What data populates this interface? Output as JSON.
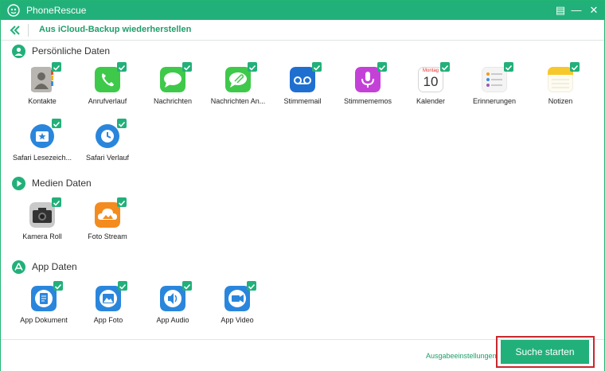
{
  "window": {
    "title": "PhoneRescue"
  },
  "titlebar": {
    "menu_glyph": "▤",
    "minimize_glyph": "—",
    "close_glyph": "✕"
  },
  "header": {
    "heading": "Aus iCloud-Backup wiederherstellen"
  },
  "sections": {
    "personal": {
      "label": "Persönliche Daten",
      "items": [
        {
          "label": "Kontakte",
          "icon": "contacts-icon",
          "checked": true
        },
        {
          "label": "Anrufverlauf",
          "icon": "phone-icon",
          "checked": true
        },
        {
          "label": "Nachrichten",
          "icon": "messages-icon",
          "checked": true
        },
        {
          "label": "Nachrichten An...",
          "icon": "message-attachments-icon",
          "checked": true
        },
        {
          "label": "Stimmemail",
          "icon": "voicemail-icon",
          "checked": true
        },
        {
          "label": "Stimmememos",
          "icon": "voice-memos-icon",
          "checked": true
        },
        {
          "label": "Kalender",
          "icon": "calendar-icon",
          "checked": true,
          "calendar_weekday": "Montag",
          "calendar_day": "10"
        },
        {
          "label": "Erinnerungen",
          "icon": "reminders-icon",
          "checked": true
        },
        {
          "label": "Notizen",
          "icon": "notes-icon",
          "checked": true
        },
        {
          "label": "Safari Lesezeich...",
          "icon": "safari-bookmarks-icon",
          "checked": true
        },
        {
          "label": "Safari Verlauf",
          "icon": "safari-history-icon",
          "checked": true
        }
      ]
    },
    "media": {
      "label": "Medien Daten",
      "items": [
        {
          "label": "Kamera Roll",
          "icon": "camera-icon",
          "checked": true
        },
        {
          "label": "Foto Stream",
          "icon": "photo-stream-icon",
          "checked": true
        }
      ]
    },
    "apps": {
      "label": "App Daten",
      "items": [
        {
          "label": "App Dokument",
          "icon": "app-document-icon",
          "checked": true
        },
        {
          "label": "App Foto",
          "icon": "app-photo-icon",
          "checked": true
        },
        {
          "label": "App Audio",
          "icon": "app-audio-icon",
          "checked": true
        },
        {
          "label": "App Video",
          "icon": "app-video-icon",
          "checked": true
        }
      ]
    }
  },
  "footer": {
    "settings_link": "Ausgabeeinstellungen",
    "start_button": "Suche starten"
  },
  "colors": {
    "accent": "#22b07a",
    "highlight": "#c8282d"
  }
}
